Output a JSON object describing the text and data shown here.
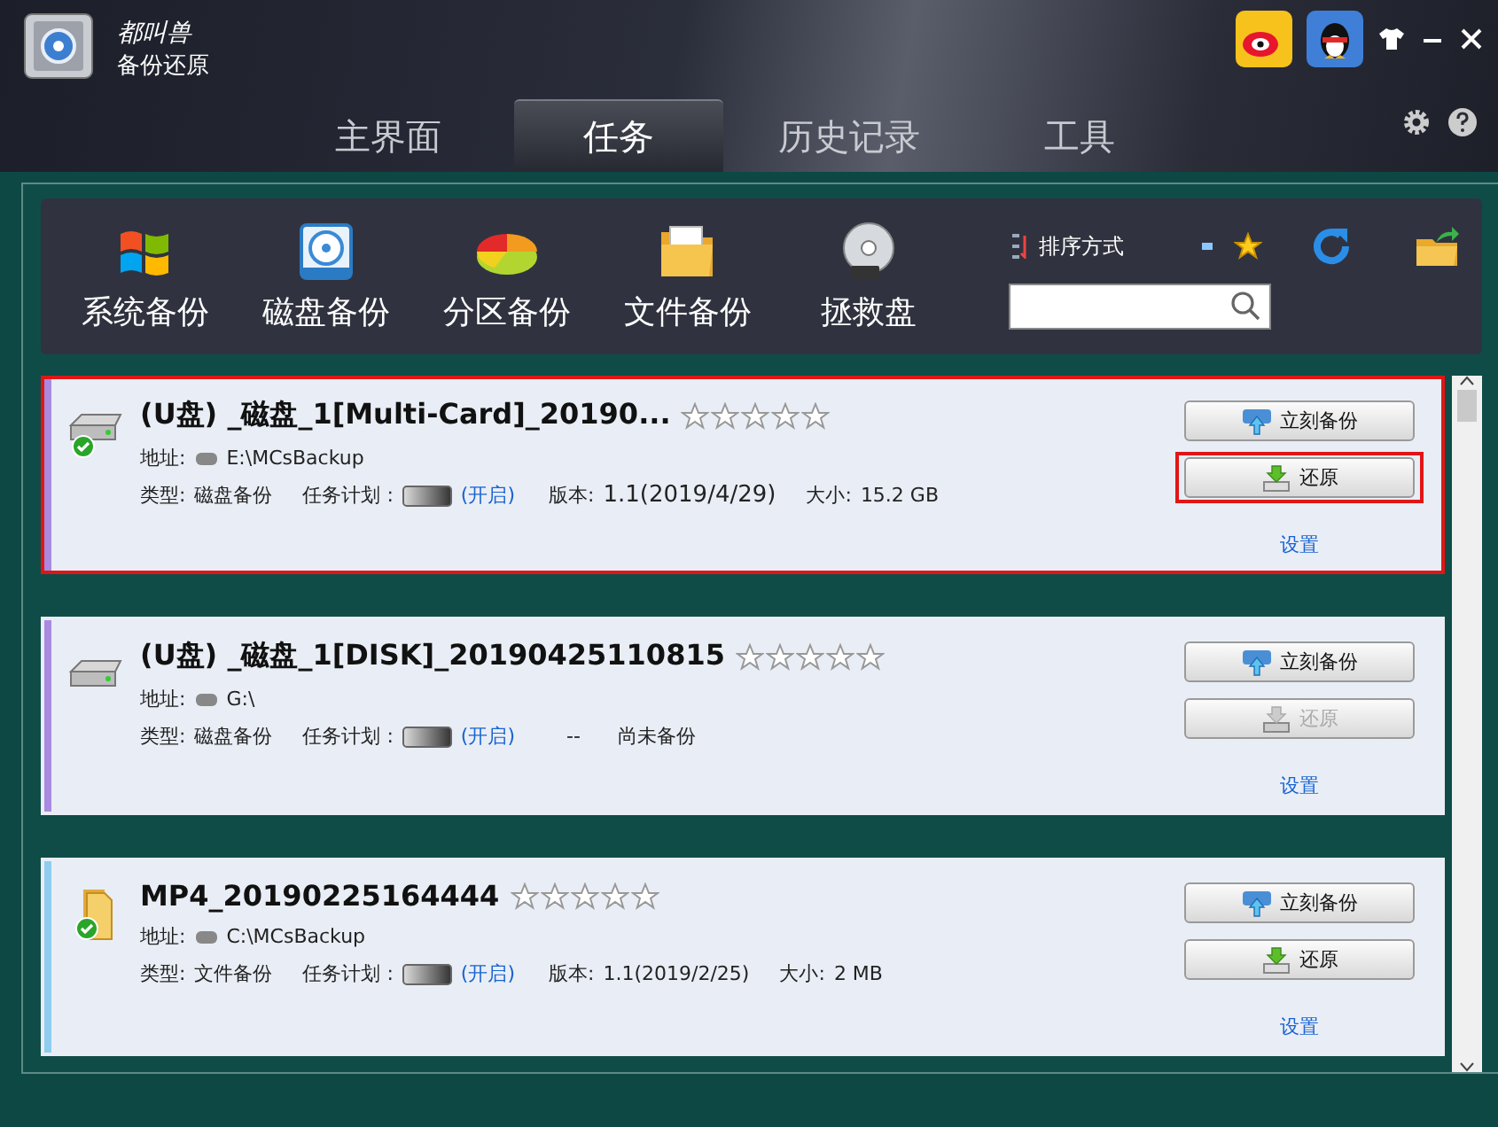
{
  "app": {
    "brand": "都叫兽",
    "product": "备份还原"
  },
  "nav_tabs": [
    {
      "label": "主界面",
      "selected": false
    },
    {
      "label": "任务",
      "selected": true
    },
    {
      "label": "历史记录",
      "selected": false
    },
    {
      "label": "工具",
      "selected": false
    }
  ],
  "toolbar": {
    "items": [
      {
        "label": "系统备份",
        "kind": "windows"
      },
      {
        "label": "磁盘备份",
        "kind": "disk"
      },
      {
        "label": "分区备份",
        "kind": "pie"
      },
      {
        "label": "文件备份",
        "kind": "folder"
      },
      {
        "label": "拯救盘",
        "kind": "cd"
      }
    ],
    "sort_label": "排序方式"
  },
  "tasks": [
    {
      "title": "(U盘) _磁盘_1[Multi-Card]_20190...",
      "stars": 0,
      "kind": "drive",
      "verified": true,
      "color": "#a98ae0",
      "highlighted": true,
      "address_label": "地址:",
      "address": "E:\\MCsBackup",
      "type_label": "类型:",
      "type": "磁盘备份",
      "schedule_label": "任务计划 :",
      "schedule_state": "(开启)",
      "version_label": "版本:",
      "version": "1.1(2019/4/29)",
      "size_label": "大小:",
      "size": "15.2 GB",
      "backup_button": "立刻备份",
      "restore_button": "还原",
      "restore_disabled": false,
      "restore_highlighted": true,
      "settings": "设置"
    },
    {
      "title": "(U盘) _磁盘_1[DISK]_20190425110815",
      "stars": 0,
      "kind": "drive",
      "verified": false,
      "color": "#a98ae0",
      "highlighted": false,
      "address_label": "地址:",
      "address": "G:\\",
      "type_label": "类型:",
      "type": "磁盘备份",
      "schedule_label": "任务计划 :",
      "schedule_state": "(开启)",
      "dash": "--",
      "status": "尚未备份",
      "backup_button": "立刻备份",
      "restore_button": "还原",
      "restore_disabled": true,
      "restore_highlighted": false,
      "settings": "设置"
    },
    {
      "title": "MP4_20190225164444",
      "stars": 0,
      "kind": "folder",
      "verified": true,
      "color": "#8ecdf0",
      "highlighted": false,
      "address_label": "地址:",
      "address": "C:\\MCsBackup",
      "type_label": "类型:",
      "type": "文件备份",
      "schedule_label": "任务计划 :",
      "schedule_state": "(开启)",
      "version_label": "版本:",
      "version": "1.1(2019/2/25)",
      "size_label": "大小:",
      "size": "2 MB",
      "backup_button": "立刻备份",
      "restore_button": "还原",
      "restore_disabled": false,
      "restore_highlighted": false,
      "settings": "设置"
    }
  ]
}
